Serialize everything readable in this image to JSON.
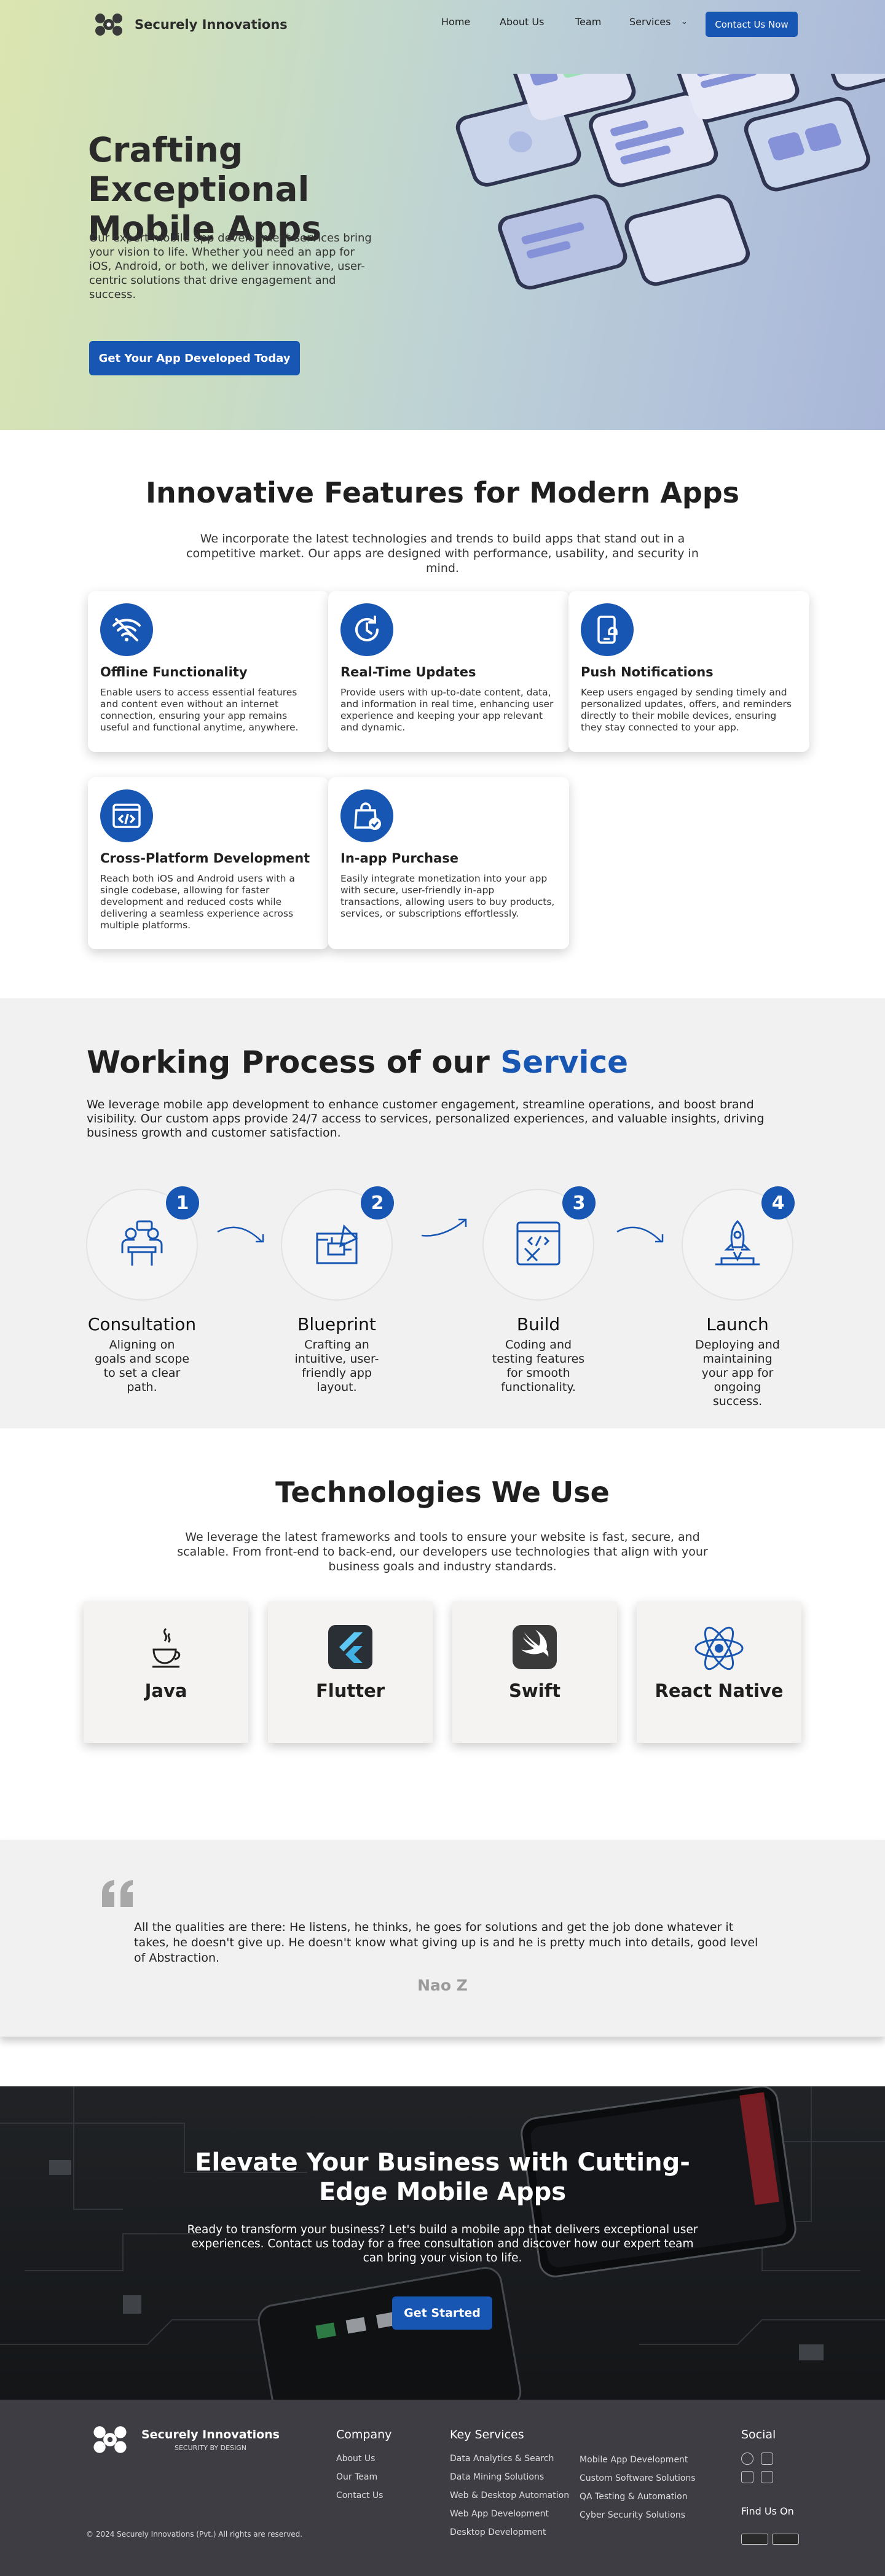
{
  "header": {
    "brand": "Securely Innovations",
    "nav": [
      "Home",
      "About Us",
      "Team",
      "Services"
    ],
    "cta": "Contact Us Now"
  },
  "hero": {
    "title": "Crafting Exceptional Mobile Apps",
    "text": "Our expert mobile app development services bring your vision to life. Whether you need an app for iOS, Android, or both, we deliver innovative, user-centric solutions that drive engagement and success.",
    "button": "Get Your App Developed Today"
  },
  "features": {
    "title": "Innovative Features for Modern Apps",
    "subtitle": "We incorporate the latest technologies and trends to build apps that stand out in a competitive market. Our apps are designed with performance, usability, and security in mind.",
    "items": [
      {
        "icon": "wifi-off-icon",
        "title": "Offline Functionality",
        "text": "Enable users to access essential features and content even without an internet connection, ensuring your app remains useful and functional anytime, anywhere."
      },
      {
        "icon": "refresh-clock-icon",
        "title": "Real-Time Updates",
        "text": "Provide users with up-to-date content, data, and information in real time, enhancing user experience and keeping your app relevant and dynamic."
      },
      {
        "icon": "mobile-bell-icon",
        "title": "Push Notifications",
        "text": "Keep users engaged by sending timely and personalized updates, offers, and reminders directly to their mobile devices, ensuring they stay connected to your app."
      },
      {
        "icon": "code-window-icon",
        "title": "Cross-Platform Development",
        "text": "Reach both iOS and Android users with a single codebase, allowing for faster development and reduced costs while delivering a seamless experience across multiple platforms."
      },
      {
        "icon": "shopping-bag-check-icon",
        "title": "In-app Purchase",
        "text": "Easily integrate monetization into your app with secure, user-friendly in-app transactions, allowing users to buy products, services, or subscriptions effortlessly."
      }
    ]
  },
  "process": {
    "title_pre": "Working Process of our",
    "title_accent": "Service",
    "text": "We leverage mobile app development to enhance customer engagement, streamline operations, and boost brand visibility. Our custom apps provide 24/7 access to services, personalized experiences, and valuable insights, driving business growth and customer satisfaction.",
    "steps": [
      {
        "num": "1",
        "title": "Consultation",
        "text": "Aligning on goals and scope to set a clear path."
      },
      {
        "num": "2",
        "title": "Blueprint",
        "text": "Crafting an intuitive, user-friendly app layout."
      },
      {
        "num": "3",
        "title": "Build",
        "text": "Coding and testing features for smooth functionality."
      },
      {
        "num": "4",
        "title": "Launch",
        "text": "Deploying and maintaining your app for ongoing success."
      }
    ]
  },
  "tech": {
    "title": "Technologies We Use",
    "subtitle": "We leverage the latest frameworks and tools to ensure your website is fast, secure, and scalable. From front-end to back-end, our developers use technologies that align with your business goals and industry standards.",
    "items": [
      "Java",
      "Flutter",
      "Swift",
      "React Native"
    ]
  },
  "testimonial": {
    "quote": "All  the qualities are there: He listens, he thinks, he goes for solutions and get the job done whatever it takes, he doesn't give up. He doesn't know what giving up is and he is pretty much into details, good level of Abstraction.",
    "author": "Nao Z"
  },
  "cta": {
    "title": "Elevate Your Business with Cutting-Edge Mobile Apps",
    "text": "Ready to transform your business? Let's build a mobile app that delivers exceptional user experiences. Contact us today for a free consultation and discover how our expert team can bring your vision to life.",
    "button": "Get Started"
  },
  "footer": {
    "brand": "Securely Innovations",
    "tagline": "SECURITY BY DESIGN",
    "company_title": "Company",
    "company_links": [
      "About Us",
      "Our Team",
      "Contact Us"
    ],
    "services_title": "Key Services",
    "services_col1": [
      "Data Analytics & Search",
      "Data Mining Solutions",
      "Web & Desktop Automation",
      "Web App Development",
      "Desktop Development"
    ],
    "services_col2": [
      "Mobile App Development",
      "Custom Software Solutions",
      "QA Testing & Automation",
      "Cyber Security Solutions"
    ],
    "social_title": "Social",
    "find_us": "Find Us On",
    "copyright": "© 2024 Securely Innovations (Pvt.) All rights are reserved."
  },
  "colors": {
    "primary": "#1756b3",
    "footer_bg": "#3d3d43",
    "section_gray": "#f1f1f1"
  }
}
